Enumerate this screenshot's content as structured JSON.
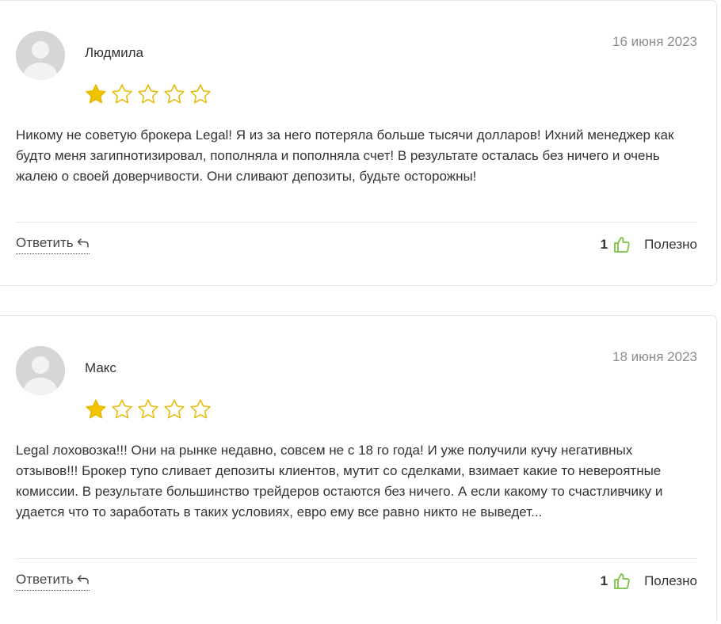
{
  "colors": {
    "star_filled": "#f2c300",
    "star_empty_stroke": "#e8b800",
    "thumb": "#7cc142",
    "date": "#8c8c8c",
    "avatar_bg": "#d6d6d6"
  },
  "reviews": [
    {
      "author": "Людмила",
      "date": "16 июня 2023",
      "rating": 1,
      "rating_max": 5,
      "text": "Никому не советую брокера Legal! Я из за него потеряла больше тысячи долларов! Ихний менеджер как будто меня загипнотизировал, пополняла и пополняла счет! В результате осталась без ничего и очень жалею о своей доверчивости. Они сливают депозиты, будьте осторожны!",
      "reply_label": "Ответить",
      "helpful_count": "1",
      "helpful_label": "Полезно"
    },
    {
      "author": "Макс",
      "date": "18 июня 2023",
      "rating": 1,
      "rating_max": 5,
      "text": "Legal лоховозка!!! Они на рынке недавно, совсем не с 18 го года! И уже получили кучу негативных отзывов!!! Брокер тупо сливает депозиты клиентов, мутит со сделками, взимает какие то невероятные комиссии. В результате большинство трейдеров остаются без ничего. А если какому то счастливчику и удается что то заработать в таких условиях, евро ему все равно никто не выведет...",
      "reply_label": "Ответить",
      "helpful_count": "1",
      "helpful_label": "Полезно"
    }
  ]
}
